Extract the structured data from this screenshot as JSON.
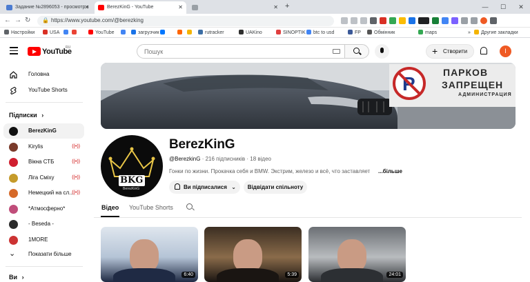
{
  "browser": {
    "tabs": [
      {
        "label": "Задание №2896053 - просмотр з",
        "icon_color": "#4b7bd1",
        "active": false
      },
      {
        "label": "BerezKinG - YouTube",
        "icon_color": "#ff0000",
        "active": true
      },
      {
        "label": "",
        "icon_color": "#9aa0a6",
        "active": false
      }
    ],
    "new_tab": "+",
    "window_buttons": {
      "minimize": "—",
      "maximize": "☐",
      "close": "✕"
    },
    "url": "https://www.youtube.com/@berezking",
    "nav": {
      "back": "←",
      "forward": "→",
      "reload": "↻"
    },
    "bookmarks": [
      {
        "label": "Настройки",
        "icon_color": "#5f6368"
      },
      {
        "label": "USA",
        "icon_color": "#d93025"
      },
      {
        "label": "",
        "icon_color": "#4285f4"
      },
      {
        "label": "",
        "icon_color": "#ea4335"
      },
      {
        "label": "YouTube",
        "icon_color": "#ff0000"
      },
      {
        "label": "",
        "icon_color": "#4285f4"
      },
      {
        "label": "загрузчик",
        "icon_color": "#1a73e8"
      },
      {
        "label": "",
        "icon_color": "#0077ff"
      },
      {
        "label": "",
        "icon_color": "#ff6600"
      },
      {
        "label": "",
        "icon_color": "#f4b400"
      },
      {
        "label": "rutracker",
        "icon_color": "#3c6ea5"
      },
      {
        "label": "UAKino",
        "icon_color": "#2f2f2f"
      },
      {
        "label": "SINOPTIK",
        "icon_color": "#e03f3f"
      },
      {
        "label": "btc to usd",
        "icon_color": "#4285f4"
      },
      {
        "label": "FP",
        "icon_color": "#3b5998"
      },
      {
        "label": "Обмінник",
        "icon_color": "#555555"
      },
      {
        "label": "maps",
        "icon_color": "#34a853"
      },
      {
        "label": "Другие закладки",
        "icon_color": "#f4b400"
      }
    ],
    "more_bookmarks": "»"
  },
  "youtube": {
    "logo_text": "YouTube",
    "logo_region": "RU",
    "search_placeholder": "Пошук",
    "create_label": "Створити",
    "user_initial": "I"
  },
  "sidebar": {
    "main_items": [
      {
        "label": "Головна",
        "icon": "home-icon"
      },
      {
        "label": "YouTube Shorts",
        "icon": "shorts-icon"
      }
    ],
    "subscriptions_title": "Підписки",
    "subscriptions_chevron": "›",
    "subscriptions": [
      {
        "label": "BerezKinG",
        "color": "#111111",
        "live": "",
        "selected": true
      },
      {
        "label": "Kirylis",
        "color": "#7a3a2a",
        "live": "((•))",
        "selected": false
      },
      {
        "label": "Вікна СТБ",
        "color": "#d01f2f",
        "live": "((•))",
        "selected": false
      },
      {
        "label": "Ліга Сміху",
        "color": "#c59b2b",
        "live": "((•))",
        "selected": false
      },
      {
        "label": "Немецкий на сл...",
        "color": "#d66a2a",
        "live": "((•))",
        "selected": false
      },
      {
        "label": "*Атмосферно*",
        "color": "#c04d7a",
        "live": "",
        "selected": false
      },
      {
        "label": "- Beseda -",
        "color": "#2a2a2a",
        "live": "",
        "selected": false
      },
      {
        "label": "1MORE",
        "color": "#c33",
        "live": "",
        "selected": false
      }
    ],
    "show_more": "Показати більше",
    "you_title": "Ви",
    "you_chevron": "›"
  },
  "channel": {
    "name": "BerezKinG",
    "handle": "@BerezkinG",
    "subscribers": "216 підписників",
    "videos": "18 відео",
    "description": "Гонки по жизни. Прокачка себя и BMW. Экстрим, железо и всё, что заставляет",
    "more": "...більше",
    "subscribed_label": "Ви підписалися",
    "community_label": "Відвідати спільноту",
    "avatar_text": "BKG",
    "avatar_subtext": "BerezKinG",
    "banner_sign_title": "ПАРКОВ",
    "banner_sign_sub": "ЗАПРЕЩЕН",
    "banner_sign_small": "АДМИНИСТРАЦИЯ",
    "tabs": [
      "Відео",
      "YouTube Shorts"
    ]
  },
  "videos": [
    {
      "duration": "6:40",
      "palette": [
        "#dfe6ee",
        "#b5c4d6",
        "#1f2a44"
      ]
    },
    {
      "duration": "5:39",
      "palette": [
        "#3b2e22",
        "#8a6b4a",
        "#1a1512"
      ]
    },
    {
      "duration": "24:01",
      "palette": [
        "#6b6f74",
        "#b9bcbf",
        "#2c2f33"
      ]
    }
  ]
}
